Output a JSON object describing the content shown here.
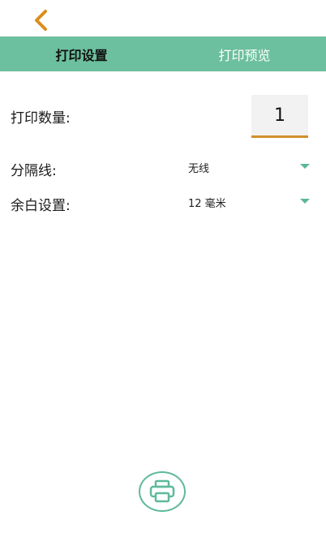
{
  "header": {
    "back_icon": "chevron-left-icon",
    "accent_color": "#d98e1f"
  },
  "tabs": [
    {
      "label": "打印设置",
      "active": true
    },
    {
      "label": "打印预览",
      "active": false
    }
  ],
  "settings": {
    "quantity": {
      "label": "打印数量:",
      "value": "1"
    },
    "separator": {
      "label": "分隔线:",
      "value": "无线"
    },
    "margin": {
      "label": "余白设置:",
      "value": "12 毫米"
    }
  },
  "footer": {
    "print_icon": "printer-icon"
  },
  "colors": {
    "tab_bar": "#6cbf9f",
    "accent": "#5fb99c",
    "input_underline": "#d0902c"
  }
}
